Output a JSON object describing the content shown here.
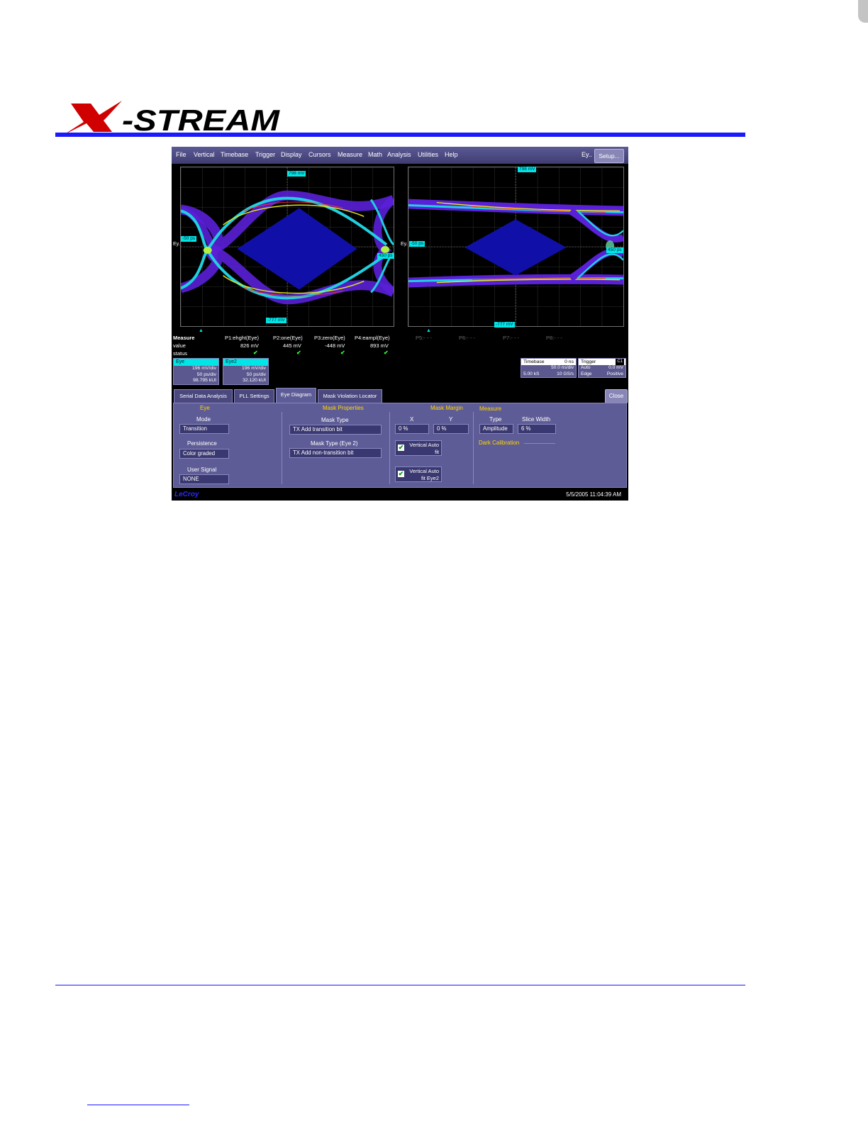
{
  "brand": {
    "logo_text": "X-STREAM"
  },
  "menu": {
    "items": [
      "File",
      "Vertical",
      "Timebase",
      "Trigger",
      "Display",
      "Cursors",
      "Measure",
      "Math",
      "Analysis",
      "Utilities",
      "Help"
    ],
    "right_label": "Ey..",
    "setup_label": "Setup..."
  },
  "eye_left": {
    "top_tag": "798 mV",
    "bottom_tag": "-777 mV",
    "left_tag": "-50 ps",
    "right_tag": "450 ps",
    "channel_label": "Ey."
  },
  "eye_right": {
    "top_tag": "798 mV",
    "bottom_tag": "-777 mV",
    "left_tag": "-50 ps",
    "right_tag": "450 ps",
    "channel_label": "Ey."
  },
  "measure": {
    "title": "Measure",
    "row_value": "value",
    "row_status": "status",
    "params": [
      {
        "name": "P1:ehght(Eye)",
        "value": "826 mV"
      },
      {
        "name": "P2:one(Eye)",
        "value": "445 mV"
      },
      {
        "name": "P3:zero(Eye)",
        "value": "-448 mV"
      },
      {
        "name": "P4:eampl(Eye)",
        "value": "893 mV"
      }
    ],
    "inactive": [
      "P5:- - -",
      "P6:- - -",
      "P7:- - -",
      "P8:- - -"
    ]
  },
  "traces": [
    {
      "title": "Eye",
      "line1": "196 mV/div",
      "line2": "50 ps/div",
      "line3": "98.795 kUI"
    },
    {
      "title": "Eye2",
      "line1": "196 mV/div",
      "line2": "50 ps/div",
      "line3": "32.120 kUI"
    }
  ],
  "timebase": {
    "title": "Timebase",
    "offset": "0 ns",
    "per_div": "50.0 ns/div",
    "samples": "5.00 kS",
    "rate": "10 GS/s"
  },
  "trigger": {
    "title": "Trigger",
    "channel": "C1",
    "mode": "Auto",
    "level": "0.0 mV",
    "type": "Edge",
    "slope": "Positive"
  },
  "tabs": [
    "Serial Data Analysis",
    "PLL Settings",
    "Eye Diagram",
    "Mask Violation Locator"
  ],
  "active_tab": "Eye Diagram",
  "close_label": "Close",
  "dialog": {
    "eye": {
      "header": "Eye",
      "mode_label": "Mode",
      "mode_value": "Transition",
      "persistence_label": "Persistence",
      "persistence_value": "Color graded",
      "user_signal_label": "User Signal",
      "user_signal_value": "NONE"
    },
    "mask_properties": {
      "header": "Mask Properties",
      "mask_type_label": "Mask Type",
      "mask_type_value": "TX Add transition bit",
      "mask_type2_label": "Mask Type (Eye 2)",
      "mask_type2_value": "TX Add non-transition bit"
    },
    "mask_margin": {
      "header": "Mask Margin",
      "x_label": "X",
      "x_value": "0 %",
      "y_label": "Y",
      "y_value": "0 %",
      "vauto_line1": "Vertical Auto",
      "vauto_line2": "fit",
      "vauto2_line1": "Vertical Auto",
      "vauto2_line2": "fit Eye2"
    },
    "measure": {
      "header": "Measure",
      "type_label": "Type",
      "type_value": "Amplitude",
      "slice_label": "Slice Width",
      "slice_value": "6 %",
      "dark_calibration": "Dark Calibration"
    }
  },
  "status_bar": {
    "brand": "LeCroy",
    "datetime": "5/5/2005 11:04:39 AM"
  },
  "colors": {
    "accent_rule": "#1a1aff",
    "logo_red": "#d00000",
    "tag_cyan": "#00e6e6",
    "panel": "#5e5c96",
    "mask": "#1010a8"
  }
}
